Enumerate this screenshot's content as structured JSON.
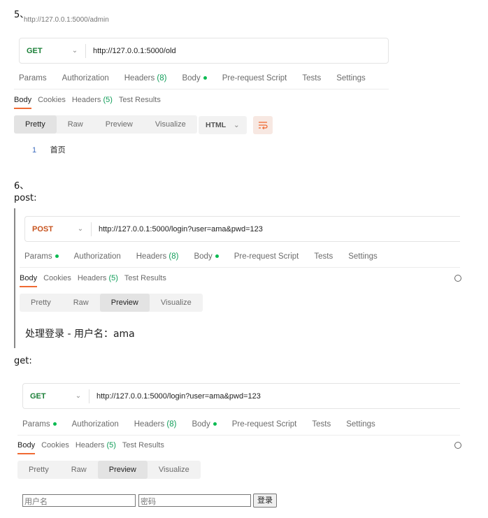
{
  "colors": {
    "accent_orange": "#f06a33",
    "post_orange": "#c7531e",
    "get_green": "#1a7f37",
    "count_green": "#0f9d58",
    "dot_green": "#0cbb52",
    "line_blue": "#3b6bbd"
  },
  "section5": {
    "number": "5、",
    "faded_url": "http://127.0.0.1:5000/admin",
    "method": "GET",
    "url": "http://127.0.0.1:5000/old",
    "request_tabs": {
      "params": "Params",
      "authorization": "Authorization",
      "headers": "Headers",
      "headers_count": "(8)",
      "body": "Body",
      "pre_request": "Pre-request Script",
      "tests": "Tests",
      "settings": "Settings"
    },
    "response_tabs": {
      "body": "Body",
      "cookies": "Cookies",
      "headers": "Headers",
      "headers_count": "(5)",
      "test_results": "Test Results"
    },
    "view_modes": [
      "Pretty",
      "Raw",
      "Preview",
      "Visualize"
    ],
    "format": "HTML",
    "line_number": "1",
    "line_content": "首页"
  },
  "section6": {
    "number": "6、",
    "post_label": "post:",
    "post": {
      "method": "POST",
      "url": "http://127.0.0.1:5000/login?user=ama&pwd=123",
      "request_tabs": {
        "params": "Params",
        "authorization": "Authorization",
        "headers": "Headers",
        "headers_count": "(8)",
        "body": "Body",
        "pre_request": "Pre-request Script",
        "tests": "Tests",
        "settings": "Settings"
      },
      "response_tabs": {
        "body": "Body",
        "cookies": "Cookies",
        "headers": "Headers",
        "headers_count": "(5)",
        "test_results": "Test Results"
      },
      "view_modes": [
        "Pretty",
        "Raw",
        "Preview",
        "Visualize"
      ],
      "preview_text": "处理登录 - 用户名：ama"
    },
    "get_label": "get:",
    "get": {
      "method": "GET",
      "url": "http://127.0.0.1:5000/login?user=ama&pwd=123",
      "request_tabs": {
        "params": "Params",
        "authorization": "Authorization",
        "headers": "Headers",
        "headers_count": "(8)",
        "body": "Body",
        "pre_request": "Pre-request Script",
        "tests": "Tests",
        "settings": "Settings"
      },
      "response_tabs": {
        "body": "Body",
        "cookies": "Cookies",
        "headers": "Headers",
        "headers_count": "(5)",
        "test_results": "Test Results"
      },
      "view_modes": [
        "Pretty",
        "Raw",
        "Preview",
        "Visualize"
      ],
      "username_placeholder": "用户名",
      "password_placeholder": "密码",
      "login_button": "登录"
    }
  }
}
